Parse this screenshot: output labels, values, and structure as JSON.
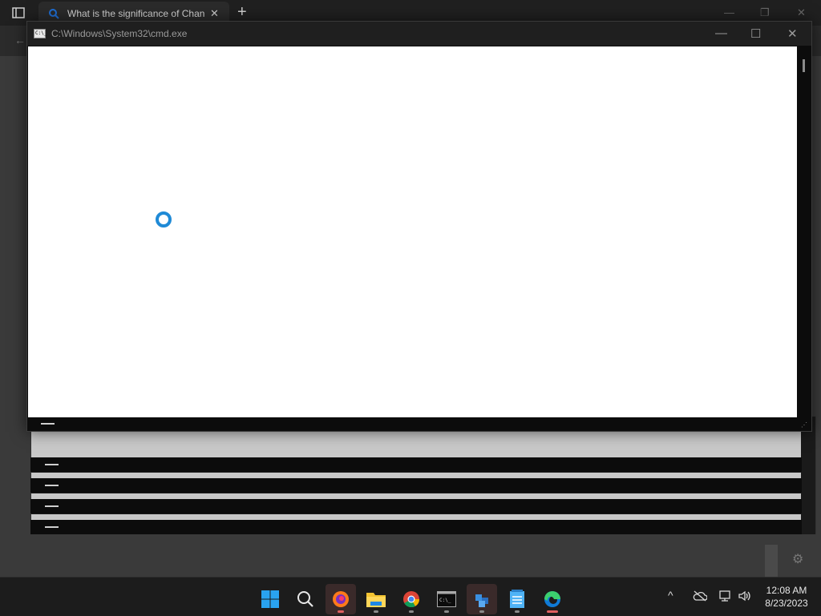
{
  "browser": {
    "tab_title": "What is the significance of Chan",
    "tab_close": "✕",
    "new_tab": "+",
    "back_icon": "←",
    "minimize": "—",
    "restore": "❐",
    "close": "✕"
  },
  "cmd_window": {
    "title": "C:\\Windows\\System32\\cmd.exe",
    "icon_text": "C:\\_",
    "minimize": "—",
    "maximize": "☐",
    "close": "✕"
  },
  "taskbar": {
    "apps": [
      "start",
      "search",
      "firefox",
      "file-explorer",
      "chrome",
      "terminal",
      "app",
      "notepad",
      "edge"
    ],
    "tray": {
      "chevron": "^",
      "time": "12:08 AM",
      "date": "8/23/2023"
    }
  },
  "colors": {
    "spinner": "#1f8ad6",
    "accent": "#e06060",
    "windows_blue": "#29a3f0"
  }
}
